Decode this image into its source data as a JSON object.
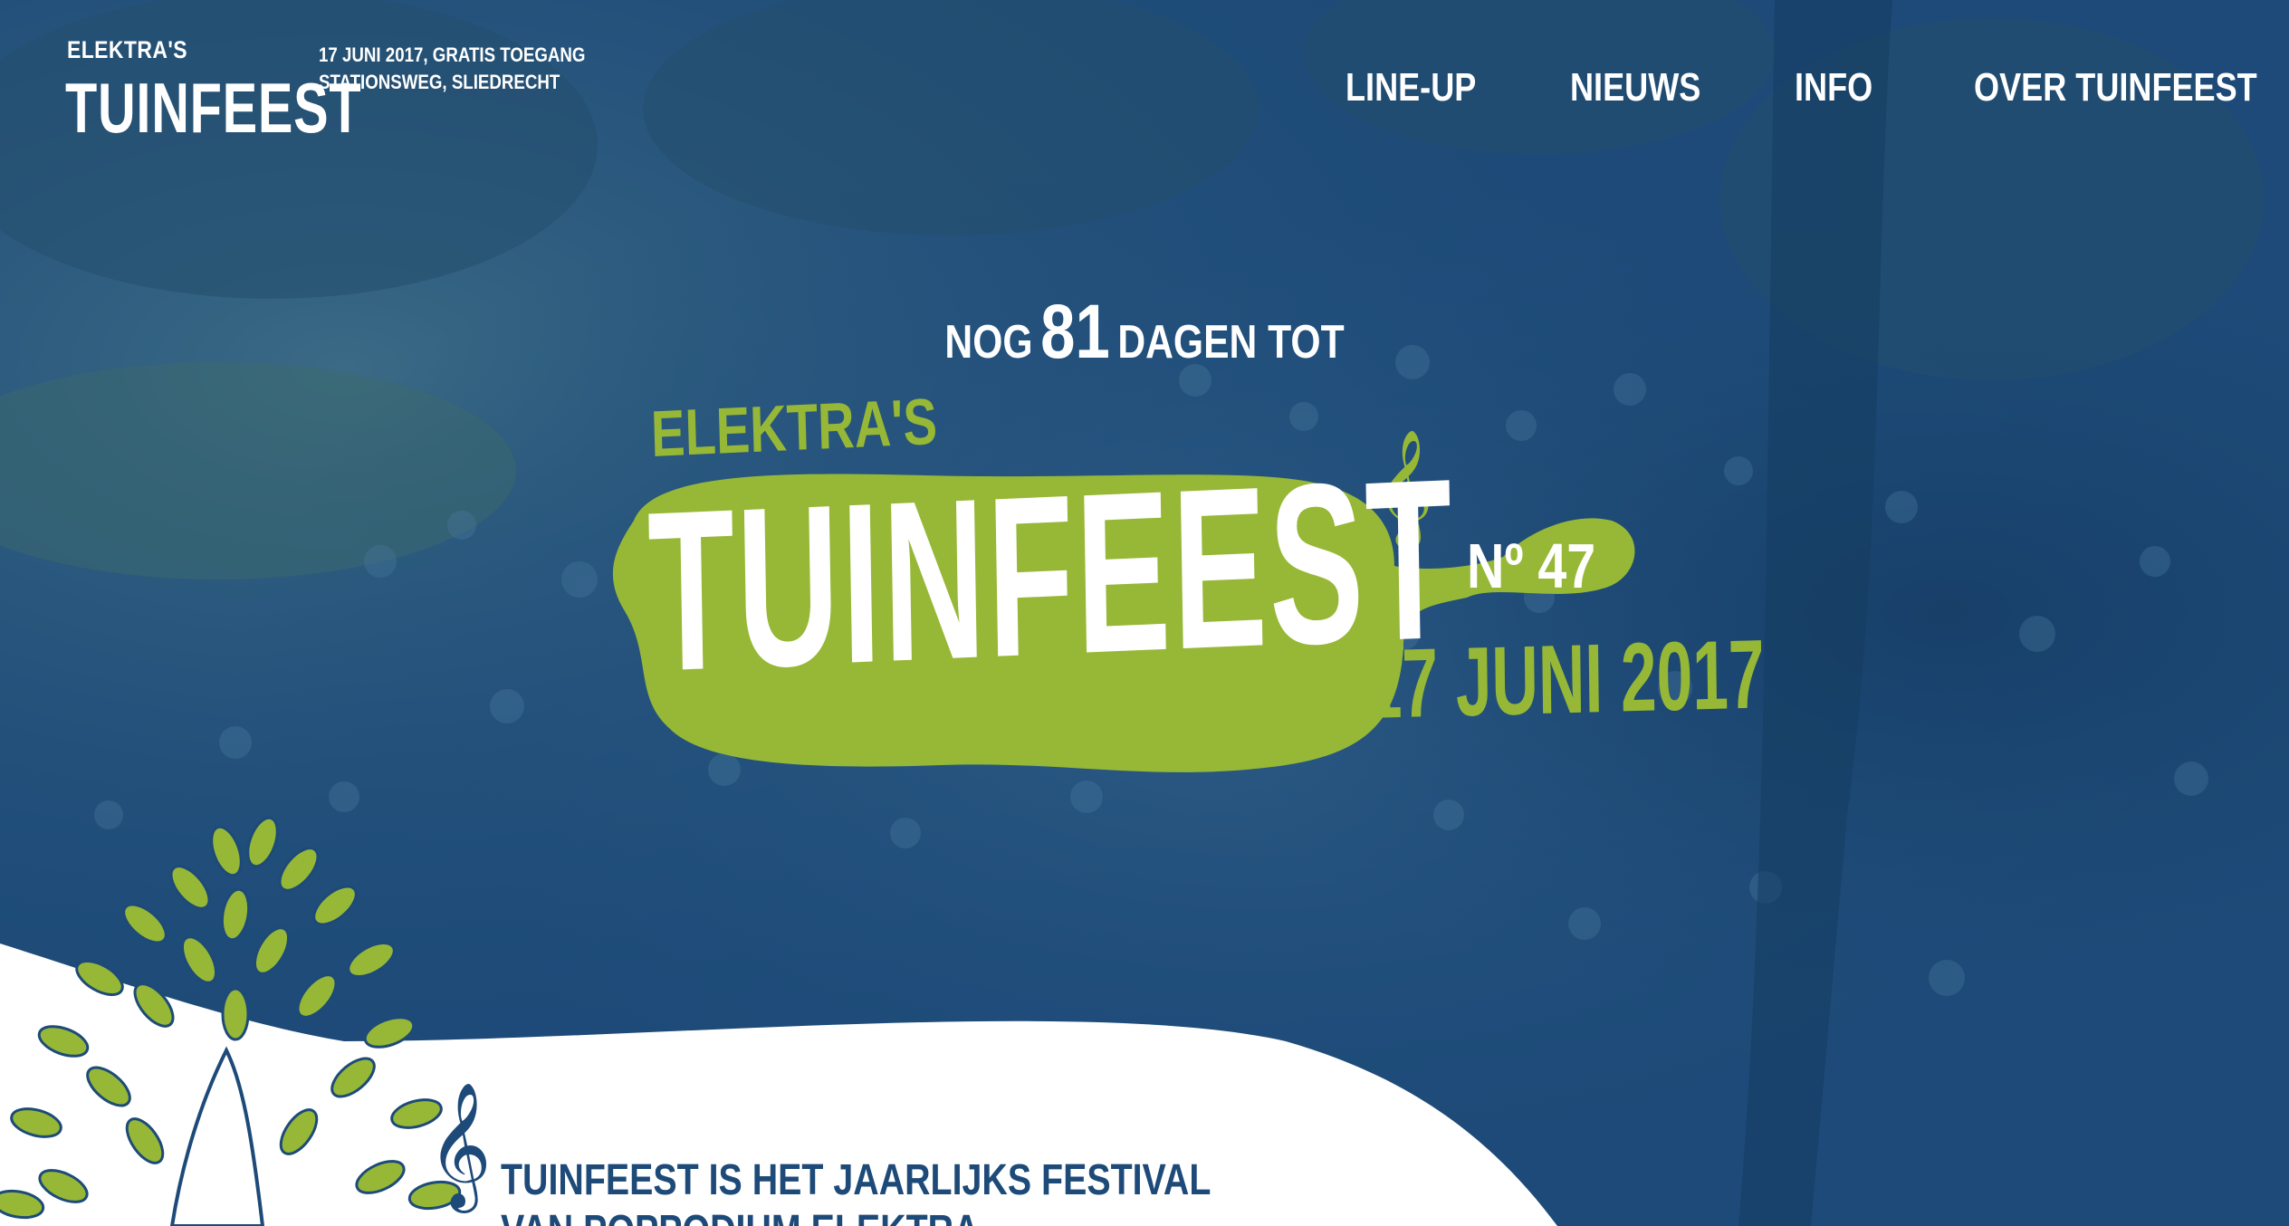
{
  "header": {
    "brand_small": "ELEKTRA'S",
    "brand_big": "TUINFEEST",
    "event_line1": "17 JUNI 2017, GRATIS TOEGANG",
    "event_line2": "STATIONSWEG, SLIEDRECHT"
  },
  "nav": {
    "items": [
      {
        "label": "LINE-UP"
      },
      {
        "label": "NIEUWS"
      },
      {
        "label": "INFO"
      },
      {
        "label": "OVER TUINFEEST"
      }
    ]
  },
  "hero": {
    "countdown_prefix": "NOG",
    "countdown_number": "81",
    "countdown_suffix": "DAGEN TOT",
    "logo_elektra": "ELEKTRA'S",
    "logo_title": "TUINFEEST",
    "logo_number": "Nº 47",
    "logo_date": "17 JUNI 2017"
  },
  "intro": {
    "line1": "TUINFEEST IS HET JAARLIJKS FESTIVAL",
    "line2": "VAN POPPODIUM ELEKTRA"
  },
  "colors": {
    "overlay_blue": "#1d4a78",
    "brand_green": "#96b836",
    "text_white": "#ffffff",
    "text_navy": "#1d4a78"
  },
  "icons": [
    "treble-clef-icon",
    "tree-illustration"
  ]
}
